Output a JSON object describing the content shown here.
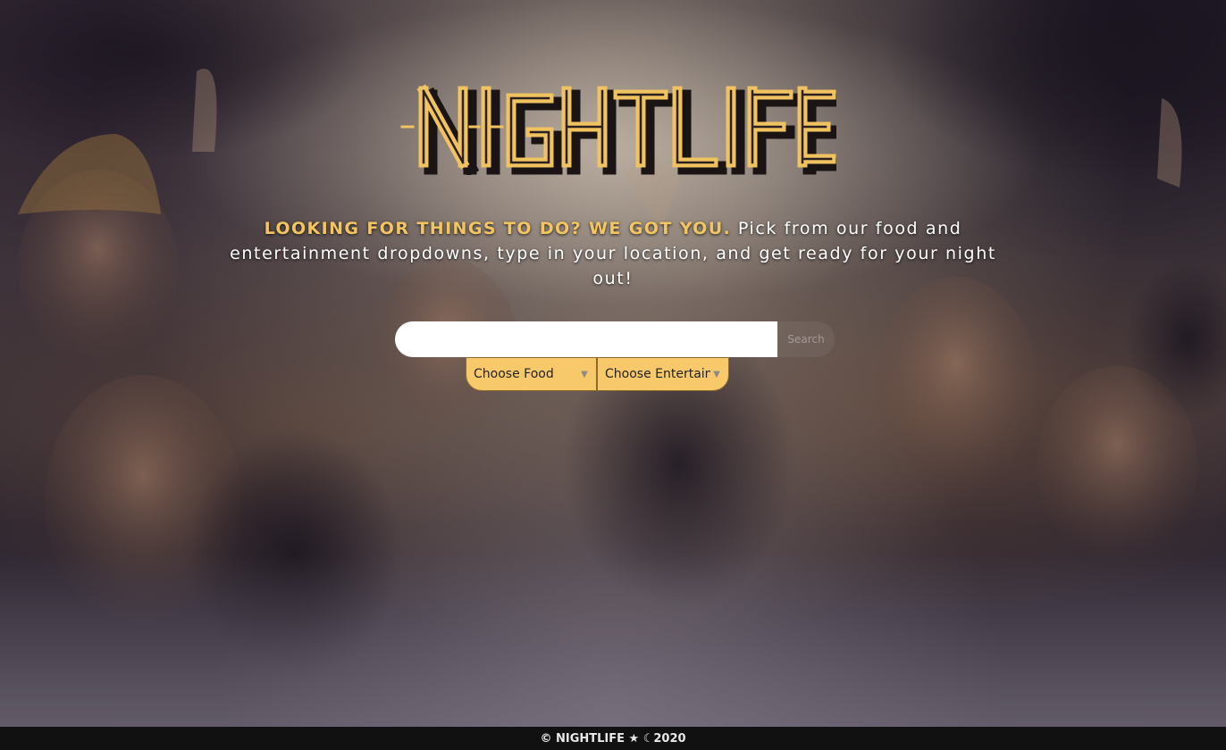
{
  "header": {
    "logo_text": "NIGHTLIFE"
  },
  "tagline": {
    "highlight": "LOOKING FOR THINGS TO DO? WE GOT YOU.",
    "body": " Pick from our food and entertainment dropdowns, type in your location, and get ready for your night out!"
  },
  "search": {
    "value": "",
    "placeholder": "",
    "button_label": "Search"
  },
  "filters": {
    "food": {
      "selected": "Choose Food"
    },
    "entertainment": {
      "selected": "Choose Entertainment"
    }
  },
  "footer": {
    "text": "© NIGHTLIFE ★ ☾2020"
  },
  "colors": {
    "accent": "#f3c561",
    "dropdown_bg": "#f7c96a",
    "footer_bg": "#111111"
  },
  "icons": {
    "dropdown_arrow": "caret-down-icon",
    "footer_star": "star-icon",
    "footer_moon": "moon-icon"
  }
}
